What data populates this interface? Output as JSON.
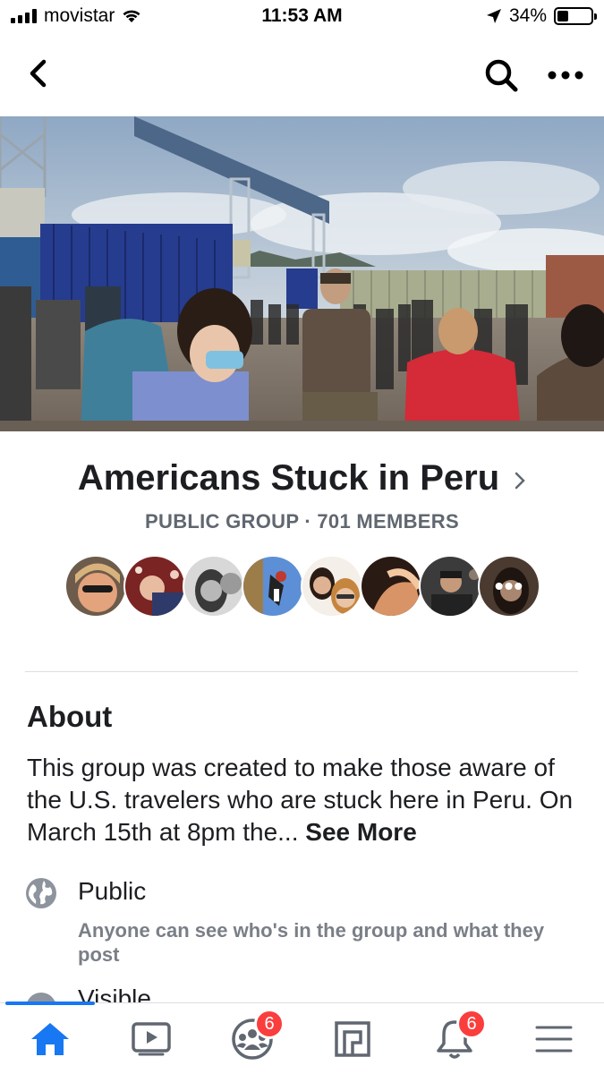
{
  "status_bar": {
    "carrier": "movistar",
    "time": "11:53 AM",
    "battery": "34%",
    "battery_level": 0.34
  },
  "nav": {
    "back_icon": "back-chevron-icon",
    "search_icon": "search-icon",
    "more_icon": "more-horizontal-icon"
  },
  "group": {
    "name": "Americans Stuck in Peru",
    "meta": "PUBLIC GROUP · 701 MEMBERS",
    "member_avatars": 8,
    "more_members_icon": "more-dots-icon"
  },
  "about": {
    "title": "About",
    "description": "This group was created to make those aware of the U.S. travelers who are stuck here in Peru.  On March 15th at 8pm the...",
    "see_more": "See More",
    "privacy_label": "Public",
    "privacy_desc": "Anyone can see who's in the group and what they post",
    "next_item_label": "Visible"
  },
  "tab_bar": {
    "tabs": [
      {
        "icon": "home-icon",
        "active": true
      },
      {
        "icon": "watch-icon"
      },
      {
        "icon": "groups-icon",
        "badge": "6"
      },
      {
        "icon": "marketplace-icon"
      },
      {
        "icon": "notifications-icon",
        "badge": "6"
      },
      {
        "icon": "menu-icon"
      }
    ]
  },
  "colors": {
    "accent": "#1877f2",
    "badge": "#fa3e3e",
    "secondary_text": "#606770"
  }
}
